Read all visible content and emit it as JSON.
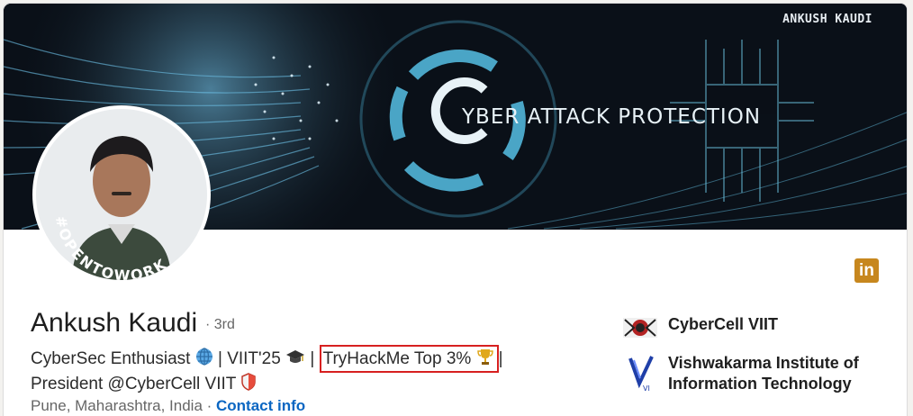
{
  "banner": {
    "signature": "ANKUSH KAUDI",
    "title": "YBER ATTACK PROTECTION"
  },
  "avatar": {
    "badge_text": "#OPENTOWORK"
  },
  "profile": {
    "name": "Ankush Kaudi",
    "degree": "· 3rd",
    "headline_part1": "CyberSec Enthusiast",
    "headline_part2": "| VIIT'25",
    "headline_sep": "|",
    "headline_highlight": "TryHackMe Top 3%",
    "headline_sep2": "|",
    "headline_line2": "President @CyberCell VIIT",
    "location": "Pune, Maharashtra, India",
    "location_sep": " · ",
    "contact_label": "Contact info"
  },
  "orgs": [
    {
      "name": "CyberCell VIIT"
    },
    {
      "name_line1": "Vishwakarma Institute of",
      "name_line2": "Information Technology",
      "logo_text": "VI"
    }
  ],
  "linkedin_button": {
    "label": "in"
  },
  "colors": {
    "highlight_box": "#d72020",
    "link": "#0a66c2",
    "linkedin": "#c7871e",
    "badge_green": "#3f7d2a"
  }
}
